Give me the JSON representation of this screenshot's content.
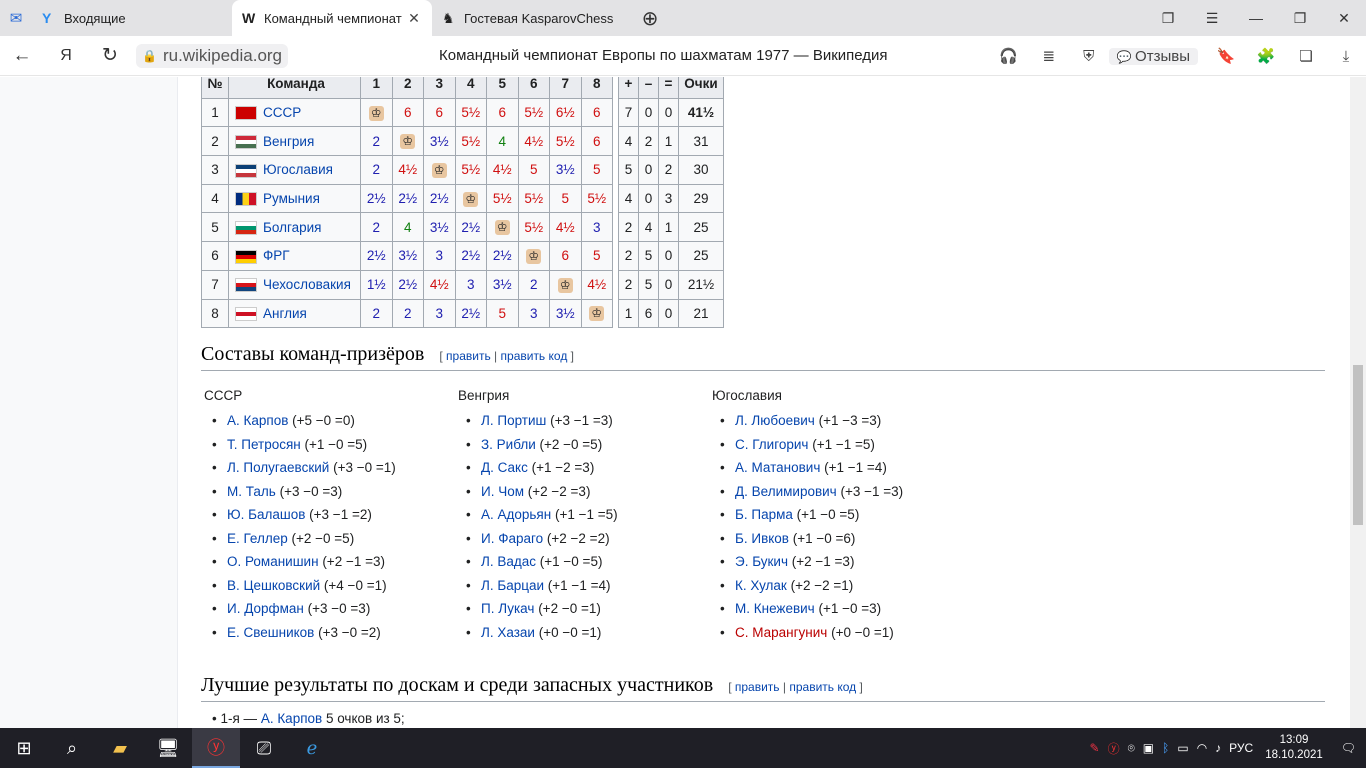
{
  "browser": {
    "tabs": [
      {
        "label": "Входящие",
        "icon": "mail-icon",
        "fav": "Y"
      },
      {
        "label": "Командный чемпионат",
        "icon": "wikipedia-icon",
        "fav": "W",
        "active": true
      },
      {
        "label": "Гостевая KasparovChess",
        "icon": "chess-icon",
        "fav": "♞"
      }
    ],
    "url": "ru.wikipedia.org",
    "page_title": "Командный чемпионат Европы по шахматам 1977 — Википедия",
    "reviews_label": "Отзывы"
  },
  "table": {
    "headers": [
      "№",
      "Команда",
      "1",
      "2",
      "3",
      "4",
      "5",
      "6",
      "7",
      "8",
      "+",
      "–",
      "=",
      "Очки"
    ],
    "rows": [
      {
        "n": "1",
        "team": "СССР",
        "flag": [
          "#cc0000",
          "#cc0000",
          "#cc0000"
        ],
        "r": [
          [
            "♔",
            "k"
          ],
          [
            "6",
            "w"
          ],
          [
            "6",
            "w"
          ],
          [
            "5½",
            "w"
          ],
          [
            "6",
            "w"
          ],
          [
            "5½",
            "w"
          ],
          [
            "6½",
            "w"
          ],
          [
            "6",
            "w"
          ]
        ],
        "p": "7",
        "m": "0",
        "e": "0",
        "pts": "41½",
        "bold": true
      },
      {
        "n": "2",
        "team": "Венгрия",
        "flag": [
          "#ce2939",
          "#ffffff",
          "#477050"
        ],
        "r": [
          [
            "2",
            "l"
          ],
          [
            "♔",
            "k"
          ],
          [
            "3½",
            "l"
          ],
          [
            "5½",
            "w"
          ],
          [
            "4",
            "d"
          ],
          [
            "4½",
            "w"
          ],
          [
            "5½",
            "w"
          ],
          [
            "6",
            "w"
          ]
        ],
        "p": "4",
        "m": "2",
        "e": "1",
        "pts": "31"
      },
      {
        "n": "3",
        "team": "Югославия",
        "flag": [
          "#0c4076",
          "#ffffff",
          "#c6363c"
        ],
        "r": [
          [
            "2",
            "l"
          ],
          [
            "4½",
            "w"
          ],
          [
            "♔",
            "k"
          ],
          [
            "5½",
            "w"
          ],
          [
            "4½",
            "w"
          ],
          [
            "5",
            "w"
          ],
          [
            "3½",
            "l"
          ],
          [
            "5",
            "w"
          ]
        ],
        "p": "5",
        "m": "0",
        "e": "2",
        "pts": "30"
      },
      {
        "n": "4",
        "team": "Румыния",
        "flag": [
          "#002b7f",
          "#fcd116",
          "#ce1126"
        ],
        "vertical": true,
        "r": [
          [
            "2½",
            "l"
          ],
          [
            "2½",
            "l"
          ],
          [
            "2½",
            "l"
          ],
          [
            "♔",
            "k"
          ],
          [
            "5½",
            "w"
          ],
          [
            "5½",
            "w"
          ],
          [
            "5",
            "w"
          ],
          [
            "5½",
            "w"
          ]
        ],
        "p": "4",
        "m": "0",
        "e": "3",
        "pts": "29"
      },
      {
        "n": "5",
        "team": "Болгария",
        "flag": [
          "#ffffff",
          "#00966e",
          "#d62612"
        ],
        "r": [
          [
            "2",
            "l"
          ],
          [
            "4",
            "d"
          ],
          [
            "3½",
            "l"
          ],
          [
            "2½",
            "l"
          ],
          [
            "♔",
            "k"
          ],
          [
            "5½",
            "w"
          ],
          [
            "4½",
            "w"
          ],
          [
            "3",
            "l"
          ]
        ],
        "p": "2",
        "m": "4",
        "e": "1",
        "pts": "25"
      },
      {
        "n": "6",
        "team": "ФРГ",
        "flag": [
          "#000000",
          "#dd0000",
          "#ffce00"
        ],
        "r": [
          [
            "2½",
            "l"
          ],
          [
            "3½",
            "l"
          ],
          [
            "3",
            "l"
          ],
          [
            "2½",
            "l"
          ],
          [
            "2½",
            "l"
          ],
          [
            "♔",
            "k"
          ],
          [
            "6",
            "w"
          ],
          [
            "5",
            "w"
          ]
        ],
        "p": "2",
        "m": "5",
        "e": "0",
        "pts": "25"
      },
      {
        "n": "7",
        "team": "Чехословакия",
        "flag": [
          "#ffffff",
          "#d7141a",
          "#11457e"
        ],
        "r": [
          [
            "1½",
            "l"
          ],
          [
            "2½",
            "l"
          ],
          [
            "4½",
            "w"
          ],
          [
            "3",
            "l"
          ],
          [
            "3½",
            "l"
          ],
          [
            "2",
            "l"
          ],
          [
            "♔",
            "k"
          ],
          [
            "4½",
            "w"
          ]
        ],
        "p": "2",
        "m": "5",
        "e": "0",
        "pts": "21½"
      },
      {
        "n": "8",
        "team": "Англия",
        "flag": [
          "#ffffff",
          "#ce1124",
          "#ffffff"
        ],
        "r": [
          [
            "2",
            "l"
          ],
          [
            "2",
            "l"
          ],
          [
            "3",
            "l"
          ],
          [
            "2½",
            "l"
          ],
          [
            "5",
            "w"
          ],
          [
            "3",
            "l"
          ],
          [
            "3½",
            "l"
          ],
          [
            "♔",
            "k"
          ]
        ],
        "p": "1",
        "m": "6",
        "e": "0",
        "pts": "21"
      }
    ]
  },
  "section1": {
    "title": "Составы команд-призёров",
    "edit": "править",
    "edit_code": "править код",
    "open": "[",
    "sep": "|",
    "close": "]"
  },
  "squads": [
    {
      "team": "СССР",
      "players": [
        {
          "name": "А. Карпов",
          "score": "(+5 −0 =0)"
        },
        {
          "name": "Т. Петросян",
          "score": "(+1 −0 =5)"
        },
        {
          "name": "Л. Полугаевский",
          "score": "(+3 −0 =1)"
        },
        {
          "name": "М. Таль",
          "score": "(+3 −0 =3)"
        },
        {
          "name": "Ю. Балашов",
          "score": "(+3 −1 =2)"
        },
        {
          "name": "Е. Геллер",
          "score": "(+2 −0 =5)"
        },
        {
          "name": "О. Романишин",
          "score": "(+2 −1 =3)"
        },
        {
          "name": "В. Цешковский",
          "score": "(+4 −0 =1)"
        },
        {
          "name": "И. Дорфман",
          "score": "(+3 −0 =3)"
        },
        {
          "name": "Е. Свешников",
          "score": "(+3 −0 =2)"
        }
      ]
    },
    {
      "team": "Венгрия",
      "players": [
        {
          "name": "Л. Портиш",
          "score": "(+3 −1 =3)"
        },
        {
          "name": "З. Рибли",
          "score": "(+2 −0 =5)"
        },
        {
          "name": "Д. Сакс",
          "score": "(+1 −2 =3)"
        },
        {
          "name": "И. Чом",
          "score": "(+2 −2 =3)"
        },
        {
          "name": "А. Адорьян",
          "score": "(+1 −1 =5)"
        },
        {
          "name": "И. Фараго",
          "score": "(+2 −2 =2)"
        },
        {
          "name": "Л. Вадас",
          "score": "(+1 −0 =5)"
        },
        {
          "name": "Л. Барцаи",
          "score": "(+1 −1 =4)"
        },
        {
          "name": "П. Лукач",
          "score": "(+2 −0 =1)"
        },
        {
          "name": "Л. Хазаи",
          "score": "(+0 −0 =1)"
        }
      ]
    },
    {
      "team": "Югославия",
      "players": [
        {
          "name": "Л. Любоевич",
          "score": "(+1 −3 =3)"
        },
        {
          "name": "С. Глигорич",
          "score": "(+1 −1 =5)"
        },
        {
          "name": "А. Матанович",
          "score": "(+1 −1 =4)"
        },
        {
          "name": "Д. Велимирович",
          "score": "(+3 −1 =3)"
        },
        {
          "name": "Б. Парма",
          "score": "(+1 −0 =5)"
        },
        {
          "name": "Б. Ивков",
          "score": "(+1 −0 =6)"
        },
        {
          "name": "Э. Букич",
          "score": "(+2 −1 =3)"
        },
        {
          "name": "К. Хулак",
          "score": "(+2 −2 =1)"
        },
        {
          "name": "М. Кнежевич",
          "score": "(+1 −0 =3)"
        },
        {
          "name": "С. Марангунич",
          "score": "(+0 −0 =1)",
          "red": true
        }
      ]
    }
  ],
  "section2": {
    "title": "Лучшие результаты по доскам и среди запасных участников",
    "edit": "править",
    "edit_code": "править код",
    "open": "[",
    "sep": "|",
    "close": "]"
  },
  "best": {
    "prefix": "1-я — ",
    "name": "А. Карпов",
    "rest": " 5 очков из 5;"
  },
  "taskbar": {
    "lang": "РУС",
    "time": "13:09",
    "date": "18.10.2021"
  }
}
